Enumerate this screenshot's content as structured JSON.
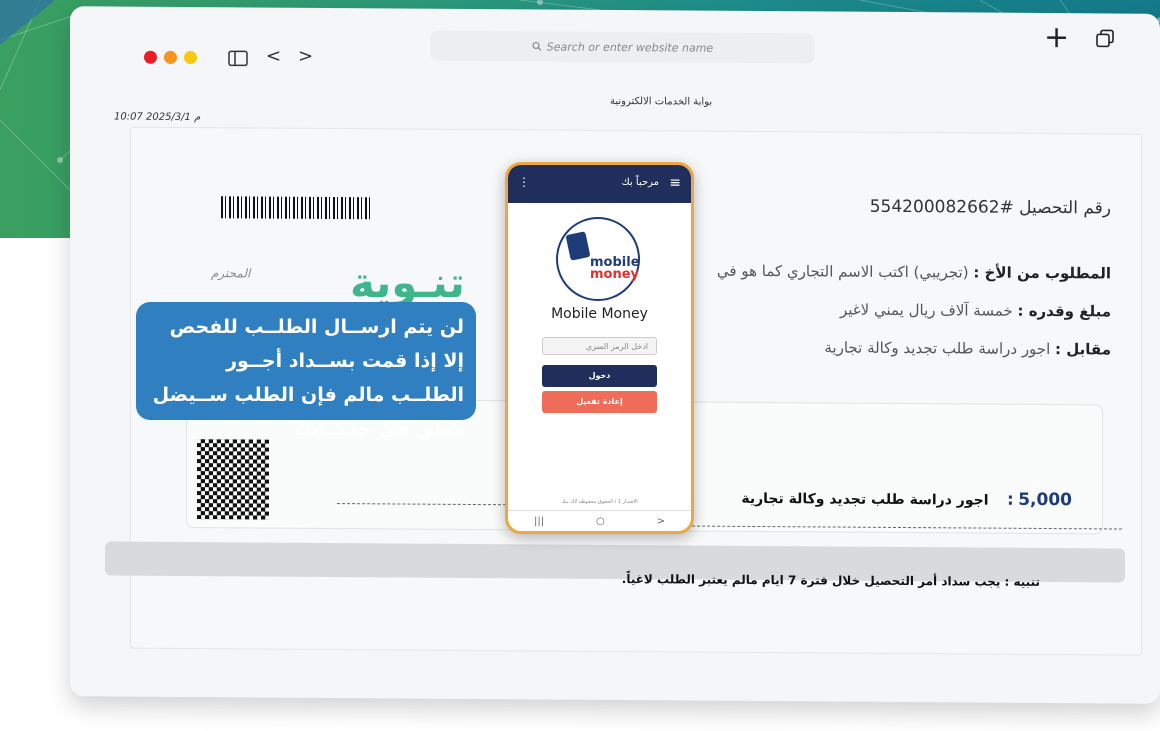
{
  "browser": {
    "search_placeholder": "Search or enter website name",
    "back_glyph": "<",
    "forward_glyph": ">",
    "new_tab_glyph": "+",
    "icons": [
      "sidebar-icon",
      "back-icon",
      "forward-icon",
      "search-icon",
      "plus-icon",
      "tabs-icon"
    ]
  },
  "page": {
    "site_title": "بوابة الخدمات الالكترونية",
    "timestamp": "10:07 2025/3/1 م"
  },
  "receipt": {
    "number_label": "رقم التحصيل #554200082662",
    "requested_label": "المطلوب من الأخ :",
    "requested_value": "(تجريبي) اكتب الاسم التجاري كما هو في",
    "respected": "المحترم",
    "amount_label": "مبلغ وقدره :",
    "amount_value": "خمسة آلاف ريال يمني لاغير",
    "for_label": "مقابل :",
    "for_value": "اجور دراسة طلب تجديد وكالة تجارية",
    "amount_num": "5,000",
    "amount_sep": ":",
    "amount_desc": "اجور دراسة طلب تجديد وكالة تجارية",
    "warning": "تنبيه : يجب سداد أمر التحصيل خلال فترة 7 ايام مالم يعتبر الطلب لاغياً."
  },
  "notice": {
    "title": "تنـوية",
    "body": "لن يتم ارســال الطلــب للفحص إلا إذا قمت بســداد أجــور الطلــب مالم فإن الطلب ســيضل معلق في حســابك"
  },
  "phone": {
    "welcome": "مرحباً بك",
    "menu_glyph": "≡",
    "dots_glyph": "⋮",
    "logo_text_top": "mobile",
    "logo_text_bottom": "money",
    "app_name": "Mobile Money",
    "pin_placeholder": "ادخل الرمز السري",
    "login_button": "دخول",
    "reset_button": "إعادة تفعيل",
    "footer": "الاصدار 1 / الحقوق محفوظة لاك بنك",
    "nav": [
      "|||",
      "○",
      ">"
    ]
  },
  "colors": {
    "band_start": "#3a9f5f",
    "band_end": "#137a8a",
    "notice_blue": "#2f7fc1",
    "notice_green": "#3fb58c",
    "phone_border": "#f0a640",
    "phone_header": "#1f2e5a",
    "reset_red": "#ef6b5a",
    "traffic": [
      "#ed1c24",
      "#f7941d",
      "#f9c80e"
    ]
  }
}
